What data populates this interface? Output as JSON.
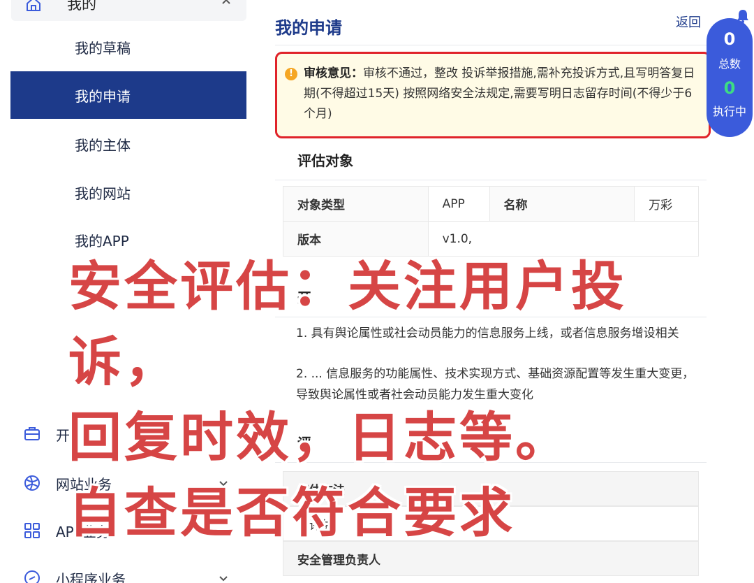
{
  "sidebar": {
    "top_item": "我的",
    "sub_items": [
      {
        "label": "我的草稿"
      },
      {
        "label": "我的申请"
      },
      {
        "label": "我的主体"
      },
      {
        "label": "我的网站"
      },
      {
        "label": "我的APP"
      }
    ],
    "group_items": [
      {
        "label": "开",
        "icon": "briefcase-icon"
      },
      {
        "label": "网站业务",
        "icon": "globe-icon"
      },
      {
        "label": "APP业务",
        "icon": "grid-icon"
      },
      {
        "label": "小程序业务",
        "icon": "link-icon"
      }
    ]
  },
  "main": {
    "title": "我的申请",
    "back": "返回",
    "review": {
      "label": "审核意见：",
      "text": "审核不通过，整改 投诉举报措施,需补充投诉方式,且写明答复日期(不得超过15天) 按照网络安全法规定,需要写明日志留存时间(不得少于6个月)"
    },
    "eval_object": {
      "heading": "评估对象",
      "rows": [
        {
          "k1": "对象类型",
          "v1": "APP",
          "k2": "名称",
          "v2": "万彩"
        },
        {
          "k1": "版本",
          "v1": "v1.0,"
        }
      ]
    },
    "section2_heading": "开",
    "paragraphs": [
      "1. 具有舆论属性或社会动员能力的信息服务上线，或者信息服务增设相关",
      "2. ... 信息服务的功能属性、技术实现方式、基础资源配置等发生重大变更，导致舆论属性或者社会动员能力发生重大变化"
    ],
    "section3_heading": "评",
    "method": {
      "k1": "评估方法",
      "v1": "自评估",
      "k2": "安全管理负责人"
    }
  },
  "widget": {
    "total_count": "0",
    "total_label": "总数",
    "running_count": "0",
    "running_label": "执行中"
  },
  "overlay": {
    "line1": "安全评估：关注用户投诉，",
    "line2": "回复时效，日志等。",
    "line3": "自查是否符合要求"
  },
  "colors": {
    "accent": "#1d3a8a",
    "review_border": "#e0232a",
    "review_bg": "#fffbe6",
    "overlay_text": "#d64545",
    "widget_bg": "#3b5bdb"
  }
}
